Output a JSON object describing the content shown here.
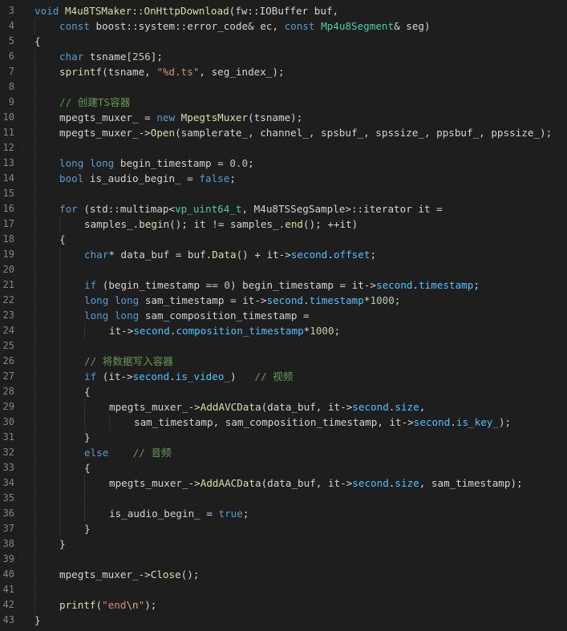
{
  "editor": {
    "lines": [
      {
        "n": "3",
        "indent": 0,
        "tokens": [
          [
            "kw",
            "void"
          ],
          [
            "pln",
            " "
          ],
          [
            "fn",
            "M4u8TSMaker::OnHttpDownload"
          ],
          [
            "pln",
            "(fw::IOBuffer buf,"
          ]
        ]
      },
      {
        "n": "4",
        "indent": 1,
        "tokens": [
          [
            "kw",
            "const"
          ],
          [
            "pln",
            " boost::system::error_code& ec, "
          ],
          [
            "kw",
            "const"
          ],
          [
            "pln",
            " "
          ],
          [
            "ty",
            "Mp4u8Segment"
          ],
          [
            "pln",
            "& seg)"
          ]
        ]
      },
      {
        "n": "5",
        "indent": 0,
        "tokens": [
          [
            "pln",
            "{"
          ]
        ]
      },
      {
        "n": "6",
        "indent": 1,
        "tokens": [
          [
            "kw",
            "char"
          ],
          [
            "pln",
            " tsname["
          ],
          [
            "num",
            "256"
          ],
          [
            "pln",
            "];"
          ]
        ]
      },
      {
        "n": "7",
        "indent": 1,
        "tokens": [
          [
            "fn",
            "sprintf"
          ],
          [
            "pln",
            "(tsname, "
          ],
          [
            "str",
            "\"%d.ts\""
          ],
          [
            "pln",
            ", seg_index_);"
          ]
        ]
      },
      {
        "n": "8",
        "indent": 1,
        "tokens": []
      },
      {
        "n": "9",
        "indent": 1,
        "tokens": [
          [
            "cm",
            "// 创建TS容器"
          ]
        ]
      },
      {
        "n": "10",
        "indent": 1,
        "tokens": [
          [
            "pln",
            "mpegts_muxer_ = "
          ],
          [
            "kw",
            "new"
          ],
          [
            "pln",
            " "
          ],
          [
            "fn",
            "MpegtsMuxer"
          ],
          [
            "pln",
            "(tsname);"
          ]
        ]
      },
      {
        "n": "11",
        "indent": 1,
        "tokens": [
          [
            "pln",
            "mpegts_muxer_->"
          ],
          [
            "fn",
            "Open"
          ],
          [
            "pln",
            "(samplerate_, channel_, spsbuf_, spssize_, ppsbuf_, ppssize_);"
          ]
        ]
      },
      {
        "n": "12",
        "indent": 1,
        "tokens": []
      },
      {
        "n": "13",
        "indent": 1,
        "tokens": [
          [
            "kw",
            "long"
          ],
          [
            "pln",
            " "
          ],
          [
            "kw",
            "long"
          ],
          [
            "pln",
            " begin_timestamp = "
          ],
          [
            "num",
            "0.0"
          ],
          [
            "pln",
            ";"
          ]
        ]
      },
      {
        "n": "14",
        "indent": 1,
        "tokens": [
          [
            "kw",
            "bool"
          ],
          [
            "pln",
            " is_audio_begin_ = "
          ],
          [
            "kw",
            "false"
          ],
          [
            "pln",
            ";"
          ]
        ]
      },
      {
        "n": "15",
        "indent": 1,
        "tokens": []
      },
      {
        "n": "16",
        "indent": 1,
        "tokens": [
          [
            "kw",
            "for"
          ],
          [
            "pln",
            " (std::multimap<"
          ],
          [
            "ty",
            "vp_uint64_t"
          ],
          [
            "pln",
            ", M4u8TSSegSample>::iterator it ="
          ]
        ]
      },
      {
        "n": "17",
        "indent": 2,
        "tokens": [
          [
            "pln",
            "samples_."
          ],
          [
            "fn",
            "begin"
          ],
          [
            "pln",
            "(); it != samples_."
          ],
          [
            "fn",
            "end"
          ],
          [
            "pln",
            "(); ++it)"
          ]
        ]
      },
      {
        "n": "18",
        "indent": 1,
        "tokens": [
          [
            "pln",
            "{"
          ]
        ]
      },
      {
        "n": "19",
        "indent": 2,
        "tokens": [
          [
            "kw",
            "char"
          ],
          [
            "pln",
            "* data_buf = buf."
          ],
          [
            "fn",
            "Data"
          ],
          [
            "pln",
            "() + it->"
          ],
          [
            "mem",
            "second"
          ],
          [
            "pln",
            "."
          ],
          [
            "mem",
            "offset"
          ],
          [
            "pln",
            ";"
          ]
        ]
      },
      {
        "n": "20",
        "indent": 2,
        "tokens": []
      },
      {
        "n": "21",
        "indent": 2,
        "tokens": [
          [
            "kw",
            "if"
          ],
          [
            "pln",
            " (begin_timestamp == "
          ],
          [
            "num",
            "0"
          ],
          [
            "pln",
            ") begin_timestamp = it->"
          ],
          [
            "mem",
            "second"
          ],
          [
            "pln",
            "."
          ],
          [
            "mem",
            "timestamp"
          ],
          [
            "pln",
            ";"
          ]
        ]
      },
      {
        "n": "22",
        "indent": 2,
        "tokens": [
          [
            "kw",
            "long"
          ],
          [
            "pln",
            " "
          ],
          [
            "kw",
            "long"
          ],
          [
            "pln",
            " sam_timestamp = it->"
          ],
          [
            "mem",
            "second"
          ],
          [
            "pln",
            "."
          ],
          [
            "mem",
            "timestamp"
          ],
          [
            "pln",
            "*"
          ],
          [
            "num",
            "1000"
          ],
          [
            "pln",
            ";"
          ]
        ]
      },
      {
        "n": "23",
        "indent": 2,
        "tokens": [
          [
            "kw",
            "long"
          ],
          [
            "pln",
            " "
          ],
          [
            "kw",
            "long"
          ],
          [
            "pln",
            " sam_composition_timestamp ="
          ]
        ]
      },
      {
        "n": "24",
        "indent": 3,
        "tokens": [
          [
            "pln",
            "it->"
          ],
          [
            "mem",
            "second"
          ],
          [
            "pln",
            "."
          ],
          [
            "mem",
            "composition_timestamp"
          ],
          [
            "pln",
            "*"
          ],
          [
            "num",
            "1000"
          ],
          [
            "pln",
            ";"
          ]
        ]
      },
      {
        "n": "25",
        "indent": 2,
        "tokens": []
      },
      {
        "n": "26",
        "indent": 2,
        "tokens": [
          [
            "cm",
            "// 将数据写入容器"
          ]
        ]
      },
      {
        "n": "27",
        "indent": 2,
        "tokens": [
          [
            "kw",
            "if"
          ],
          [
            "pln",
            " (it->"
          ],
          [
            "mem",
            "second"
          ],
          [
            "pln",
            "."
          ],
          [
            "mem",
            "is_video_"
          ],
          [
            "pln",
            ")   "
          ],
          [
            "cm",
            "// 视频"
          ]
        ]
      },
      {
        "n": "28",
        "indent": 2,
        "tokens": [
          [
            "pln",
            "{"
          ]
        ]
      },
      {
        "n": "29",
        "indent": 3,
        "tokens": [
          [
            "pln",
            "mpegts_muxer_->"
          ],
          [
            "fn",
            "AddAVCData"
          ],
          [
            "pln",
            "(data_buf, it->"
          ],
          [
            "mem",
            "second"
          ],
          [
            "pln",
            "."
          ],
          [
            "mem",
            "size"
          ],
          [
            "pln",
            ","
          ]
        ]
      },
      {
        "n": "30",
        "indent": 4,
        "tokens": [
          [
            "pln",
            "sam_timestamp, sam_composition_timestamp, it->"
          ],
          [
            "mem",
            "second"
          ],
          [
            "pln",
            "."
          ],
          [
            "mem",
            "is_key_"
          ],
          [
            "pln",
            ");"
          ]
        ]
      },
      {
        "n": "31",
        "indent": 2,
        "tokens": [
          [
            "pln",
            "}"
          ]
        ]
      },
      {
        "n": "32",
        "indent": 2,
        "tokens": [
          [
            "kw",
            "else"
          ],
          [
            "pln",
            "    "
          ],
          [
            "cm",
            "// 音频"
          ]
        ]
      },
      {
        "n": "33",
        "indent": 2,
        "tokens": [
          [
            "pln",
            "{"
          ]
        ]
      },
      {
        "n": "34",
        "indent": 3,
        "tokens": [
          [
            "pln",
            "mpegts_muxer_->"
          ],
          [
            "fn",
            "AddAACData"
          ],
          [
            "pln",
            "(data_buf, it->"
          ],
          [
            "mem",
            "second"
          ],
          [
            "pln",
            "."
          ],
          [
            "mem",
            "size"
          ],
          [
            "pln",
            ", sam_timestamp);"
          ]
        ]
      },
      {
        "n": "35",
        "indent": 3,
        "tokens": []
      },
      {
        "n": "36",
        "indent": 3,
        "tokens": [
          [
            "pln",
            "is_audio_begin_ = "
          ],
          [
            "kw",
            "true"
          ],
          [
            "pln",
            ";"
          ]
        ]
      },
      {
        "n": "37",
        "indent": 2,
        "tokens": [
          [
            "pln",
            "}"
          ]
        ]
      },
      {
        "n": "38",
        "indent": 1,
        "tokens": [
          [
            "pln",
            "}"
          ]
        ]
      },
      {
        "n": "39",
        "indent": 1,
        "tokens": []
      },
      {
        "n": "40",
        "indent": 1,
        "tokens": [
          [
            "pln",
            "mpegts_muxer_->"
          ],
          [
            "fn",
            "Close"
          ],
          [
            "pln",
            "();"
          ]
        ]
      },
      {
        "n": "41",
        "indent": 1,
        "tokens": []
      },
      {
        "n": "42",
        "indent": 1,
        "tokens": [
          [
            "fn",
            "printf"
          ],
          [
            "pln",
            "("
          ],
          [
            "str",
            "\"end"
          ],
          [
            "esc",
            "\\n"
          ],
          [
            "str",
            "\""
          ],
          [
            "pln",
            ");"
          ]
        ]
      },
      {
        "n": "43",
        "indent": 0,
        "tokens": [
          [
            "pln",
            "}"
          ]
        ]
      }
    ]
  },
  "theme": {
    "background": "#1e1e1e",
    "line_number": "#858585",
    "keyword": "#569cd6",
    "function": "#dcdcaa",
    "type": "#4ec9b0",
    "string": "#ce9178",
    "number": "#b5cea8",
    "comment": "#6a9955",
    "member": "#4fc1ff",
    "text": "#d4d4d4"
  }
}
